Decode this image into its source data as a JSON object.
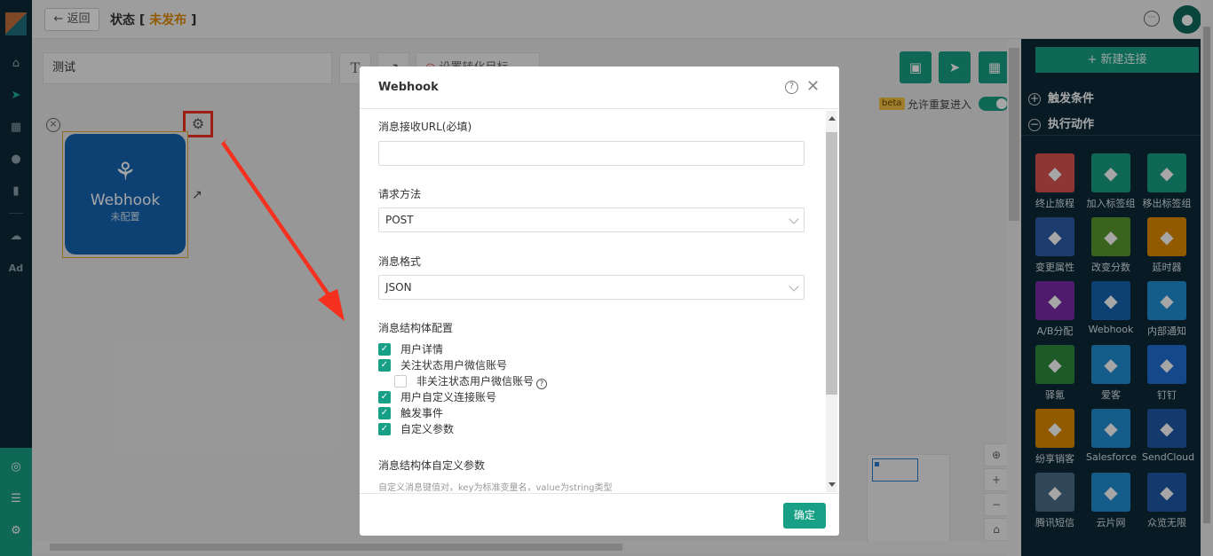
{
  "topbar": {
    "back_label": "← 返回",
    "title_prefix": "状态 [",
    "status": "未发布",
    "title_suffix": "]"
  },
  "canvas": {
    "journey_name": "测试",
    "goal_label": "设置转化目标",
    "beta_badge": "beta",
    "allow_reentry_label": "允许重复进入",
    "allow_reentry_on": true,
    "node": {
      "name": "Webhook",
      "status": "未配置"
    }
  },
  "leftnav": {
    "ad_label": "Ad"
  },
  "right_panel": {
    "new_connection": "+ 新建连接",
    "trigger_section": "触发条件",
    "action_section": "执行动作",
    "actions": [
      {
        "label": "终止旅程",
        "color": "#d9534f",
        "icon": "stop-icon"
      },
      {
        "label": "加入标签组",
        "color": "#17a085",
        "icon": "user-plus-icon"
      },
      {
        "label": "移出标签组",
        "color": "#17a085",
        "icon": "user-minus-icon"
      },
      {
        "label": "变更属性",
        "color": "#2a5da8",
        "icon": "edit-icon"
      },
      {
        "label": "改变分数",
        "color": "#5a9a2e",
        "icon": "trophy-icon"
      },
      {
        "label": "延时器",
        "color": "#e08a00",
        "icon": "hourglass-icon"
      },
      {
        "label": "A/B分配",
        "color": "#7a2ba8",
        "icon": "ab-split-icon"
      },
      {
        "label": "Webhook",
        "color": "#1565b3",
        "icon": "webhook-icon"
      },
      {
        "label": "内部通知",
        "color": "#1f8fd6",
        "icon": "bell-icon"
      },
      {
        "label": "驿氪",
        "color": "#2c8a3e",
        "icon": "spider-icon"
      },
      {
        "label": "爱客",
        "color": "#1f8fd6",
        "icon": "k-icon"
      },
      {
        "label": "钉钉",
        "color": "#1f6fd6",
        "icon": "dingtalk-icon"
      },
      {
        "label": "纷享销客",
        "color": "#e08a00",
        "icon": "fxiaoke-icon"
      },
      {
        "label": "Salesforce",
        "color": "#1f8fd6",
        "icon": "cloud-icon"
      },
      {
        "label": "SendCloud",
        "color": "#1f5aa8",
        "icon": "sendcloud-icon"
      },
      {
        "label": "腾讯短信",
        "color": "#4a6e8a",
        "icon": "tencent-cloud-icon"
      },
      {
        "label": "云片网",
        "color": "#1f8fd6",
        "icon": "yunpian-icon"
      },
      {
        "label": "众览无限",
        "color": "#1f5aa8",
        "icon": "zhonglan-icon"
      }
    ]
  },
  "modal": {
    "title": "Webhook",
    "url_label": "消息接收URL(必填)",
    "url_value": "",
    "method_label": "请求方法",
    "method_value": "POST",
    "format_label": "消息格式",
    "format_value": "JSON",
    "struct_label": "消息结构体配置",
    "options": [
      {
        "label": "用户详情",
        "checked": true,
        "indent": false
      },
      {
        "label": "关注状态用户微信账号",
        "checked": true,
        "indent": false
      },
      {
        "label": "非关注状态用户微信账号",
        "checked": false,
        "indent": true
      },
      {
        "label": "用户自定义连接账号",
        "checked": true,
        "indent": false
      },
      {
        "label": "触发事件",
        "checked": true,
        "indent": false
      },
      {
        "label": "自定义参数",
        "checked": true,
        "indent": false
      }
    ],
    "custom_label": "消息结构体自定义参数",
    "custom_hint": "自定义消息键值对，key为标准变量名，value为string类型",
    "ok_label": "确定"
  },
  "colors": {
    "accent": "#17a085",
    "highlight": "#f02e1f",
    "node": "#1565b3"
  }
}
